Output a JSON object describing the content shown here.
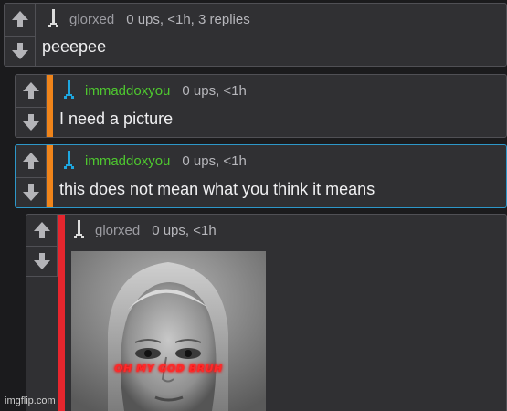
{
  "comments": [
    {
      "user": "glorxed",
      "meta": "0 ups, <1h, 3 replies",
      "text": "peeepee"
    },
    {
      "user": "immaddoxyou",
      "meta": "0 ups, <1h",
      "text": "I need a picture"
    },
    {
      "user": "immaddoxyou",
      "meta": "0 ups, <1h",
      "text": "this does not mean what you think it means"
    },
    {
      "user": "glorxed",
      "meta": "0 ups, <1h",
      "image_caption": "OH MY GOD BRUH"
    }
  ],
  "watermark": "imgflip.com",
  "colors": {
    "panel": "#303033",
    "border": "#505055",
    "accent_orange": "#f0841a",
    "accent_blue": "#2d97c9",
    "accent_red": "#e6262e",
    "user_gray": "#9c9ca2",
    "user_green": "#4ec82f",
    "icon_blue": "#1ea7e0"
  },
  "icons": {
    "upvote": "arrow-up-icon",
    "downvote": "arrow-down-icon",
    "user": "user-avatar-icon"
  }
}
